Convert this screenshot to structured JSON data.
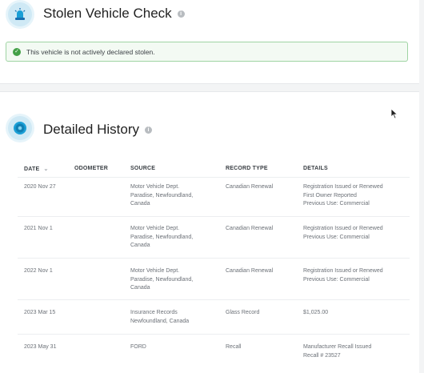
{
  "stolen": {
    "title": "Stolen Vehicle Check",
    "alert_text": "This vehicle is not actively declared stolen."
  },
  "history": {
    "title": "Detailed History",
    "columns": {
      "date": "DATE",
      "odometer": "ODOMETER",
      "source": "SOURCE",
      "record_type": "RECORD TYPE",
      "details": "DETAILS"
    },
    "rows": [
      {
        "date": "2020 Nov 27",
        "odometer": "",
        "source": [
          "Motor Vehicle Dept.",
          "Paradise, Newfoundland,",
          "Canada"
        ],
        "record_type": "Canadian Renewal",
        "details": [
          "Registration Issued or Renewed",
          "First Owner Reported",
          "Previous Use: Commercial"
        ]
      },
      {
        "date": "2021 Nov 1",
        "odometer": "",
        "source": [
          "Motor Vehicle Dept.",
          "Paradise, Newfoundland,",
          "Canada"
        ],
        "record_type": "Canadian Renewal",
        "details": [
          "Registration Issued or Renewed",
          "Previous Use: Commercial"
        ]
      },
      {
        "date": "2022 Nov 1",
        "odometer": "",
        "source": [
          "Motor Vehicle Dept.",
          "Paradise, Newfoundland,",
          "Canada"
        ],
        "record_type": "Canadian Renewal",
        "details": [
          "Registration Issued or Renewed",
          "Previous Use: Commercial"
        ]
      },
      {
        "date": "2023 Mar 15",
        "odometer": "",
        "source": [
          "Insurance Records",
          "Newfoundland, Canada"
        ],
        "record_type": "Glass Record",
        "details": [
          "$1,025.00"
        ]
      },
      {
        "date": "2023 May 31",
        "odometer": "",
        "source": [
          "FORD"
        ],
        "record_type": "Recall",
        "details": [
          "Manufacturer Recall Issued",
          "Recall # 23527"
        ]
      }
    ]
  },
  "colors": {
    "accent": "#1a9fd6",
    "success": "#43a047",
    "alert_bg": "#f3faf3",
    "alert_border": "#9fd4a3"
  },
  "icons": {
    "stolen_section": "siren-icon",
    "history_section": "history-badge-icon",
    "info": "info-icon",
    "alert": "check-circle-icon",
    "sort": "chevron-down-icon",
    "cursor": "mouse-pointer-icon"
  }
}
